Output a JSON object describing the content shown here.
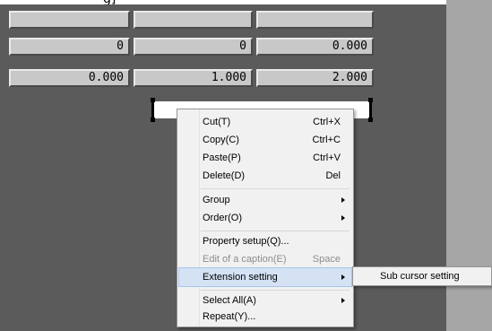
{
  "top_clip_text": "g]",
  "grid": {
    "rows": [
      [
        "",
        "",
        ""
      ],
      [
        "0",
        "0",
        "0.000"
      ],
      [
        "0.000",
        "1.000",
        "2.000"
      ]
    ]
  },
  "context_menu": {
    "items": [
      {
        "label": "Cut(T)",
        "shortcut": "Ctrl+X"
      },
      {
        "label": "Copy(C)",
        "shortcut": "Ctrl+C"
      },
      {
        "label": "Paste(P)",
        "shortcut": "Ctrl+V"
      },
      {
        "label": "Delete(D)",
        "shortcut": "Del"
      },
      {
        "label": "Group"
      },
      {
        "label": "Order(O)"
      },
      {
        "label": "Property setup(Q)..."
      },
      {
        "label": "Edit of a caption(E)",
        "shortcut": "Space",
        "disabled": true
      },
      {
        "label": "Extension setting",
        "highlighted": true
      },
      {
        "label": "Select All(A)"
      },
      {
        "label": "Repeat(Y)..."
      }
    ]
  },
  "submenu": {
    "items": [
      {
        "label": "Sub cursor setting"
      }
    ]
  }
}
